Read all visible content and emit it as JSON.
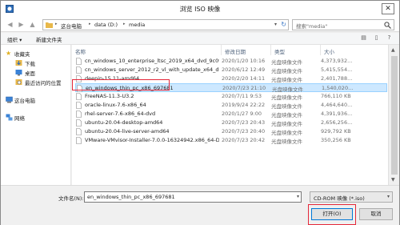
{
  "window": {
    "title": "浏览 ISO 映像",
    "close_glyph": "✕"
  },
  "address": {
    "crumbs": [
      "这台电脑",
      "data (D:)",
      "media"
    ],
    "search_placeholder": "搜索\"media\""
  },
  "toolbar": {
    "organize_label": "组织 ▾",
    "new_folder_label": "新建文件夹"
  },
  "nav": {
    "items": [
      {
        "label": "收藏夹",
        "icon": "star-icon"
      },
      {
        "label": "下载",
        "icon": "download-icon"
      },
      {
        "label": "桌面",
        "icon": "desktop-icon"
      },
      {
        "label": "最近访问的位置",
        "icon": "recent-icon"
      },
      {
        "label": "这台电脑",
        "icon": "computer-icon"
      },
      {
        "label": "网络",
        "icon": "network-icon"
      }
    ]
  },
  "columns": {
    "name": "名称",
    "date": "修改日期",
    "type": "类型",
    "size": "大小"
  },
  "files": [
    {
      "name": "cn_windows_10_enterprise_ltsc_2019_x64_dvd_9c09ff24",
      "date": "2020/1/20 10:16",
      "type": "光盘映像文件",
      "size": "4,373,932..."
    },
    {
      "name": "cn_windows_server_2012_r2_vl_with_update_x64_dvd_...",
      "date": "2020/6/12 12:49",
      "type": "光盘映像文件",
      "size": "5,415,554..."
    },
    {
      "name": "deepin-15.11-amd64",
      "date": "2020/2/20 14:11",
      "type": "光盘映像文件",
      "size": "2,401,788..."
    },
    {
      "name": "en_windows_thin_pc_x86_697681",
      "date": "2020/7/23 21:10",
      "type": "光盘映像文件",
      "size": "1,540,020..."
    },
    {
      "name": "FreeNAS-11.3-U3.2",
      "date": "2020/7/11 9:53",
      "type": "光盘映像文件",
      "size": "766,110 KB"
    },
    {
      "name": "oracle-linux-7.6-x86_64",
      "date": "2019/9/24 22:22",
      "type": "光盘映像文件",
      "size": "4,464,640..."
    },
    {
      "name": "rhel-server-7.6-x86_64-dvd",
      "date": "2020/1/27 9:00",
      "type": "光盘映像文件",
      "size": "4,391,936..."
    },
    {
      "name": "ubuntu-20.04-desktop-amd64",
      "date": "2020/7/23 20:43",
      "type": "光盘映像文件",
      "size": "2,656,256..."
    },
    {
      "name": "ubuntu-20.04-live-server-amd64",
      "date": "2020/7/23 20:40",
      "type": "光盘映像文件",
      "size": "929,792 KB"
    },
    {
      "name": "VMware-VMvisor-Installer-7.0.0-16324942.x86_64-D...",
      "date": "2020/7/23 20:42",
      "type": "光盘映像文件",
      "size": "350,256 KB"
    }
  ],
  "footer": {
    "filename_label": "文件名(N):",
    "filename_value": "en_windows_thin_pc_x86_697681",
    "filter_value": "CD-ROM 映像 (*.iso)",
    "open_label": "打开(O)",
    "cancel_label": "取消"
  },
  "colors": {
    "selection_bg": "#cde8ff",
    "highlight": "#e5283a",
    "accent": "#0078d7"
  }
}
